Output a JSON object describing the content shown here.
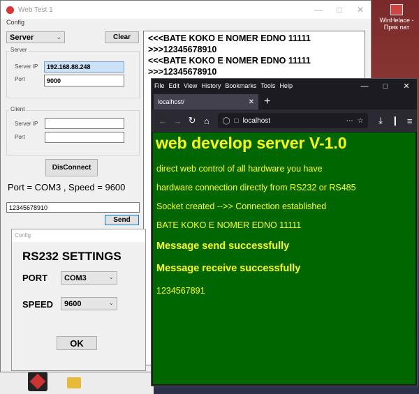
{
  "desktop": {
    "icon_label_1": "WinHelace -",
    "icon_label_2": "Пряк пат"
  },
  "window1": {
    "title": "Web Test 1",
    "menu": "Config",
    "mode_select": "Server",
    "clear_label": "Clear",
    "server_group": "Server",
    "server_ip_label": "Server IP",
    "server_ip_value": "192.168.88.248",
    "server_port_label": "Port",
    "server_port_value": "9000",
    "client_group": "Client",
    "client_ip_label": "Server IP",
    "client_ip_value": "",
    "client_port_label": "Port",
    "client_port_value": "",
    "disconnect_label": "DisConnect",
    "status_text": "Port = COM3 , Speed = 9600",
    "send_input_value": "12345678910",
    "send_label": "Send",
    "log_lines": [
      "<<<BATE KOKO E NOMER EDNO 11111",
      ">>>12345678910",
      "<<<BATE KOKO E NOMER EDNO 11111",
      ">>>12345678910"
    ]
  },
  "config_dialog": {
    "title": "Config",
    "heading": "RS232 SETTINGS",
    "port_label": "PORT",
    "port_value": "COM3",
    "speed_label": "SPEED",
    "speed_value": "9600",
    "ok_label": "OK"
  },
  "browser": {
    "menu": [
      "File",
      "Edit",
      "View",
      "History",
      "Bookmarks",
      "Tools",
      "Help"
    ],
    "tab_title": "localhost/",
    "url": "localhost",
    "page": {
      "title": "web develop server V-1.0",
      "line1": "direct web control of all hardware you have",
      "line2": "hardware connection directly from RS232 or RS485",
      "line3": "Socket created -->> Connection established",
      "line4": "BATE KOKO E NOMER EDNO 11111",
      "msg_send": "Message send successfully",
      "msg_receive": "Message receive successfully",
      "value": "1234567891"
    }
  }
}
